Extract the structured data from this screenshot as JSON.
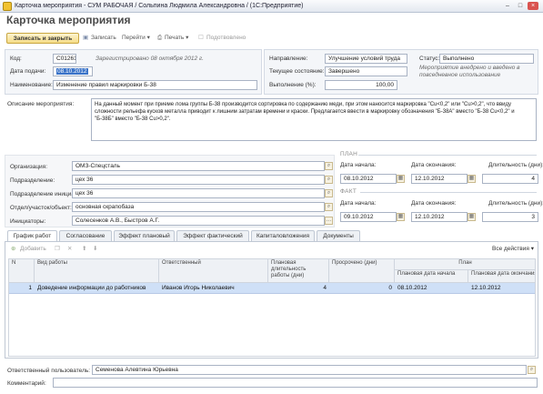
{
  "window": {
    "title": "Карточка мероприятия - СУМ РАБОЧАЯ / Сольпина Людмила Александровна / (1С:Предприятие)"
  },
  "form": {
    "title": "Карточка мероприятия"
  },
  "toolbar": {
    "save_close": "Записать и закрыть",
    "save": "Записать",
    "goto": "Перейти",
    "print": "Печать",
    "confirmed": "Подотвовлено"
  },
  "header": {
    "code_label": "Код:",
    "code_value": "С01261",
    "registered": "Зарегистрировано 08 октября 2012 г.",
    "date_label": "Дата подачи:",
    "date_value": "08.10.2012",
    "name_label": "Наименование:",
    "name_value": "Изменение правил маркировки Б-38",
    "direction_label": "Направление:",
    "direction_value": "Улучшение условий труда",
    "status_label": "Статус:",
    "status_value": "Выполнено",
    "state_label": "Текущее состояние:",
    "state_value": "Завершено",
    "note": "Мероприятие внедрено и введено в повседневное использование",
    "progress_label": "Выполнение (%):",
    "progress_value": "100,00"
  },
  "description": {
    "label": "Описание мероприятия:",
    "text": "На данный момент при приеме лома группы Б-38 производится сортировка по содержанию меди, при этом наносится маркировка \"Cu<0,2\" или \"Cu>0,2\", что ввиду сложности рельефа кусков металла приводит к лишним затратам времени и краски. Предлагается ввести в маркировку обозначения \"Б-38А\" вместо \"Б-38 Cu<0,2\" и \"Б-38Б\" вместо \"Б-38 Cu>0,2\"."
  },
  "org": {
    "org_label": "Организация:",
    "org_value": "ОМЗ-Спецсталь",
    "dept_label": "Подразделение:",
    "dept_value": "цех 36",
    "init_dept_label": "Подразделение инициатор:",
    "init_dept_value": "цех 36",
    "section_label": "Отдел/участок/объект:",
    "section_value": "основная скрапобаза",
    "initiators_label": "Инициаторы:",
    "initiators_value": "Солесенков А.В., Быстров А.Г."
  },
  "plan": {
    "section": "ПЛАН",
    "start_label": "Дата начала:",
    "end_label": "Дата окончания:",
    "duration_label": "Длительность (дни):",
    "start": "08.10.2012",
    "end": "12.10.2012",
    "duration": "4"
  },
  "fact": {
    "section": "ФАКТ",
    "start": "09.10.2012",
    "end": "12.10.2012",
    "duration": "3"
  },
  "tabs": [
    "График работ",
    "Согласование",
    "Эффект плановый",
    "Эффект фактический",
    "Капиталовложения",
    "Документы"
  ],
  "tab_toolbar": {
    "add": "Добавить",
    "all_actions": "Все действия"
  },
  "table": {
    "headers": {
      "n": "N",
      "work_type": "Вид работы",
      "responsible": "Ответственный",
      "plan_duration": "Плановая длительность работы (дни)",
      "overdue": "Просрочено (дни)",
      "plan_group": "План",
      "plan_start": "Плановая дата начала",
      "plan_end": "Плановая дата окончания"
    },
    "rows": [
      {
        "n": "1",
        "work_type": "Доведение информации до работников",
        "responsible": "Иванов Игорь Николаевич",
        "plan_duration": "4",
        "overdue": "0",
        "plan_start": "08.10.2012",
        "plan_end": "12.10.2012"
      }
    ]
  },
  "footer": {
    "user_label": "Ответственный пользователь:",
    "user_value": "Семенова Алевтина Юрьевна",
    "comment_label": "Комментарий:",
    "comment_value": ""
  },
  "colors": {
    "accent": "#fae8a6",
    "selection": "#cfe0f7",
    "border": "#a9b3c4"
  }
}
